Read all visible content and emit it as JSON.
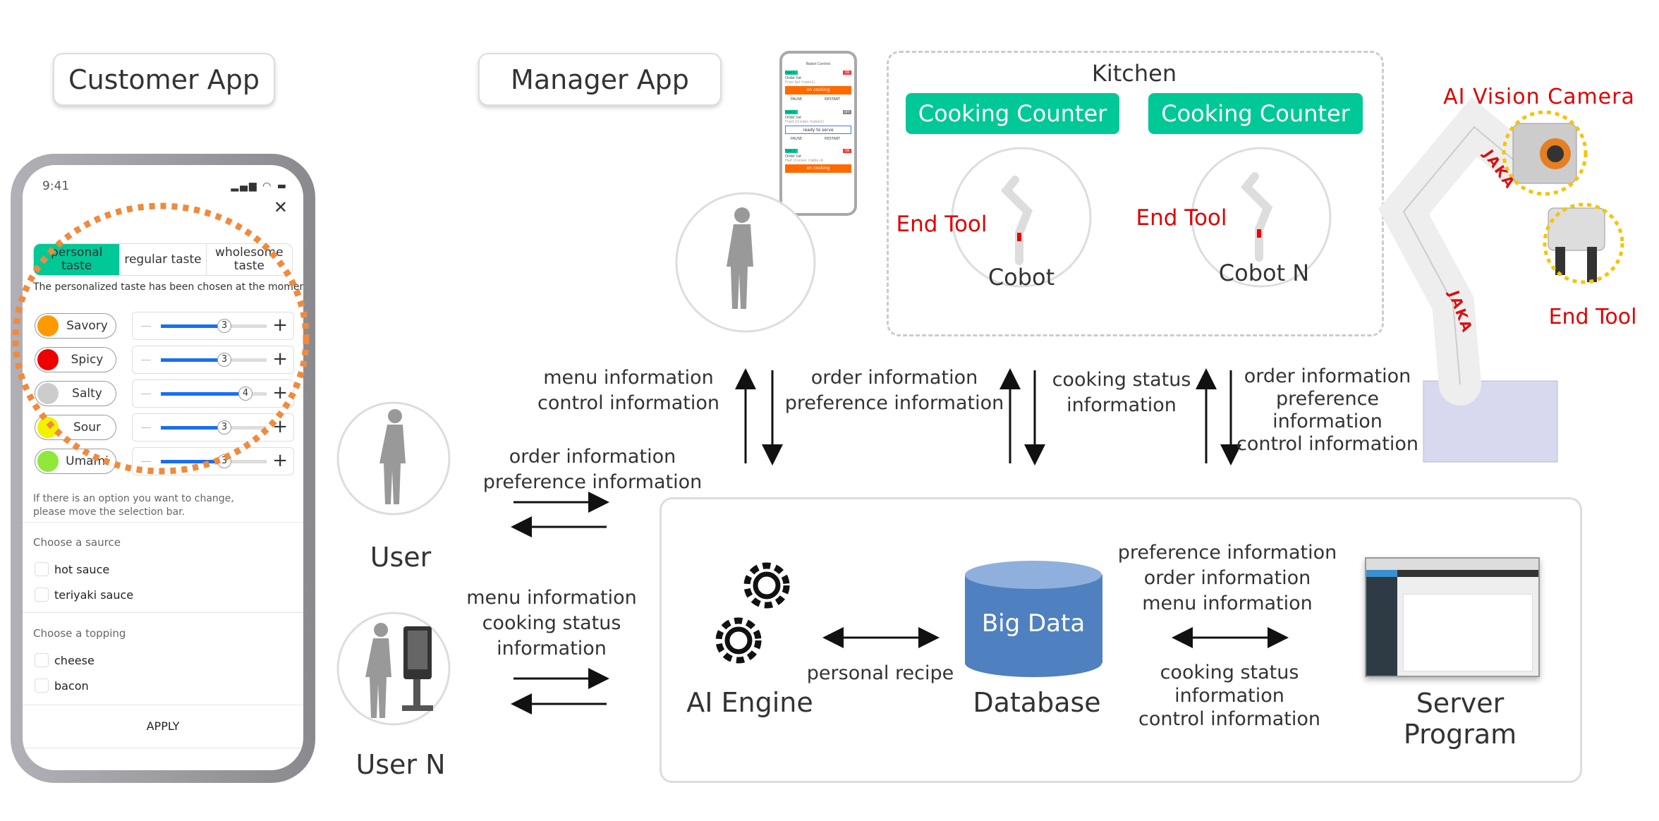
{
  "labels": {
    "customer_app": "Customer App",
    "manager_app": "Manager App",
    "kitchen": "Kitchen"
  },
  "customer_app": {
    "time": "9:41",
    "tabs": [
      {
        "label": "personal taste",
        "active": true
      },
      {
        "label": "regular taste",
        "active": false
      },
      {
        "label": "wholesome taste",
        "active": false
      }
    ],
    "status_text": "The personalized taste has been chosen at the moment.",
    "tastes": [
      {
        "name": "Savory",
        "color": "#ff9900",
        "value": 3
      },
      {
        "name": "Spicy",
        "color": "#ee0000",
        "value": 3
      },
      {
        "name": "Salty",
        "color": "#cccccc",
        "value": 4
      },
      {
        "name": "Sour",
        "color": "#f2f200",
        "value": 3
      },
      {
        "name": "Umami",
        "color": "#8fe83a",
        "value": 3
      }
    ],
    "hint_line1": "If there is an option you want to change,",
    "hint_line2": "please move the selection bar.",
    "sauce_title": "Choose a saurce",
    "sauces": [
      "hot sauce",
      "teriyaki sauce"
    ],
    "topping_title": "Choose a topping",
    "toppings": [
      "cheese",
      "bacon"
    ],
    "apply": "APPLY"
  },
  "manager_phone": {
    "title": "Robot Control",
    "cards": [
      {
        "tag": "Fryer 1",
        "state": "ON",
        "label": "Order list",
        "order": "Fries Set (table1)",
        "button": "on cooking"
      },
      {
        "tag": "Fryer 2",
        "state": "OFF",
        "label": "Order list",
        "order": "Fried Chicken (table2)",
        "button": "ready to serve"
      },
      {
        "tag": "Fryer 3",
        "state": "ON",
        "label": "Order list",
        "order": "Half Chicken (table 4)",
        "button": "on cooking"
      }
    ],
    "pause": "PAUSE",
    "restart": "RESTART"
  },
  "kitchen": {
    "counters": [
      "Cooking Counter",
      "Cooking Counter"
    ],
    "cobots": [
      "Cobot",
      "Cobot N"
    ],
    "end_tool": "End Tool"
  },
  "robot": {
    "camera": "AI Vision Camera",
    "end_tool": "End Tool",
    "brand": "JAKA"
  },
  "flows": {
    "manager_to_server": [
      "menu information",
      "control information"
    ],
    "kitchen_left": [
      "order information",
      "preference information"
    ],
    "kitchen_mid": [
      "cooking status",
      "information"
    ],
    "kitchen_right": [
      "order information",
      "preference",
      "information",
      "control information"
    ],
    "user": [
      "order information",
      "preference information"
    ],
    "user_n": [
      "menu information",
      "cooking status",
      "information"
    ]
  },
  "users": {
    "user": "User",
    "user_n": "User N"
  },
  "server": {
    "ai_engine": "AI Engine",
    "personal_recipe": "personal recipe",
    "big_data": "Big Data",
    "database": "Database",
    "top": [
      "preference information",
      "order information",
      "menu information"
    ],
    "bottom": [
      "cooking status",
      "information",
      "control information"
    ],
    "server_program": [
      "Server",
      "Program"
    ]
  },
  "colors": {
    "accent": "#00c896",
    "highlight": "#f08a3c",
    "database": "#4f80c0",
    "alert": "#e00000",
    "slider": "#1a6ff0",
    "cooking": "#ff6a00"
  }
}
